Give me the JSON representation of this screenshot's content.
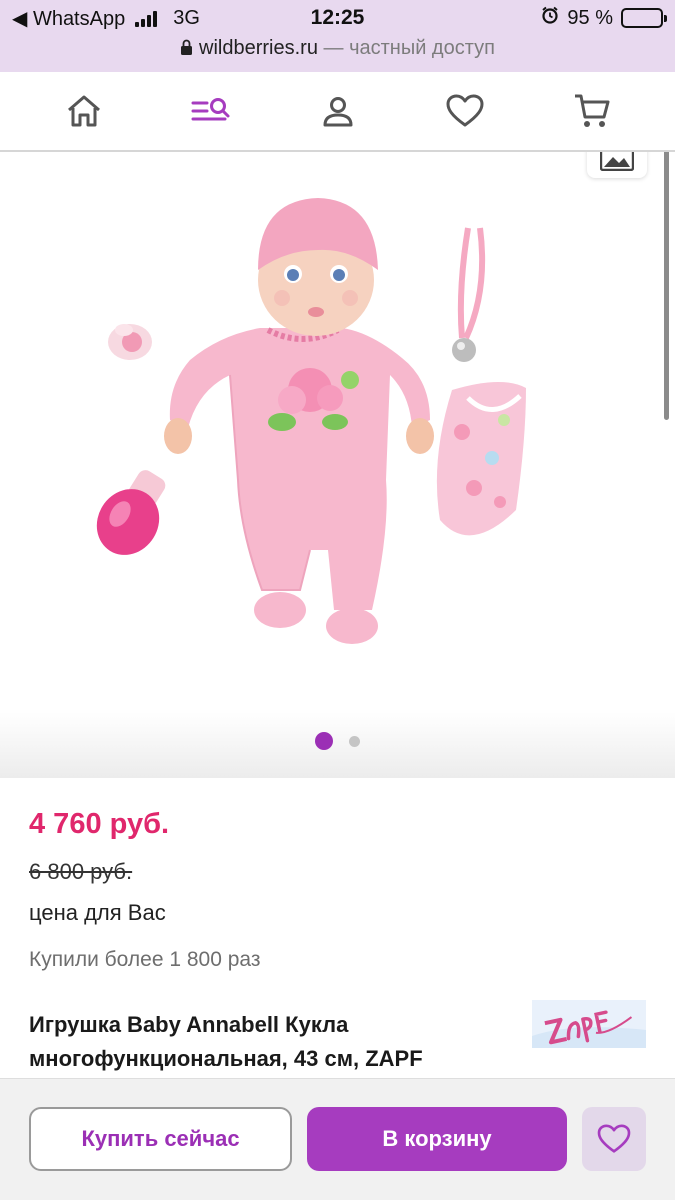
{
  "status_bar": {
    "back_app": "◀ WhatsApp",
    "network": "3G",
    "time": "12:25",
    "battery_percent": "95 %",
    "battery_level": 0.95
  },
  "url_bar": {
    "domain": "wildberries.ru",
    "suffix": " — частный доступ"
  },
  "nav": {
    "items": [
      {
        "name": "home",
        "icon": "home-icon"
      },
      {
        "name": "catalog-search",
        "icon": "menu-search-icon",
        "active": true
      },
      {
        "name": "profile",
        "icon": "user-icon"
      },
      {
        "name": "favorites",
        "icon": "heart-icon"
      },
      {
        "name": "cart",
        "icon": "cart-icon"
      }
    ]
  },
  "gallery": {
    "current_slide": 1,
    "total_slides": 2
  },
  "product": {
    "price": "4 760 руб.",
    "old_price": "6 800 руб.",
    "price_note": "цена для Вас",
    "bought_count": "Купили более 1 800 раз",
    "title": "Игрушка Baby Annabell Кукла многофункциональная, 43 см, ZAPF",
    "brand_logo_text": "Zapf Creation"
  },
  "actions": {
    "buy_now": "Купить сейчас",
    "add_to_cart": "В корзину",
    "favorite_icon": "heart-icon"
  },
  "colors": {
    "accent_purple": "#a63cbf",
    "price_pink": "#e0276c",
    "header_lilac": "#e8d9ef"
  }
}
